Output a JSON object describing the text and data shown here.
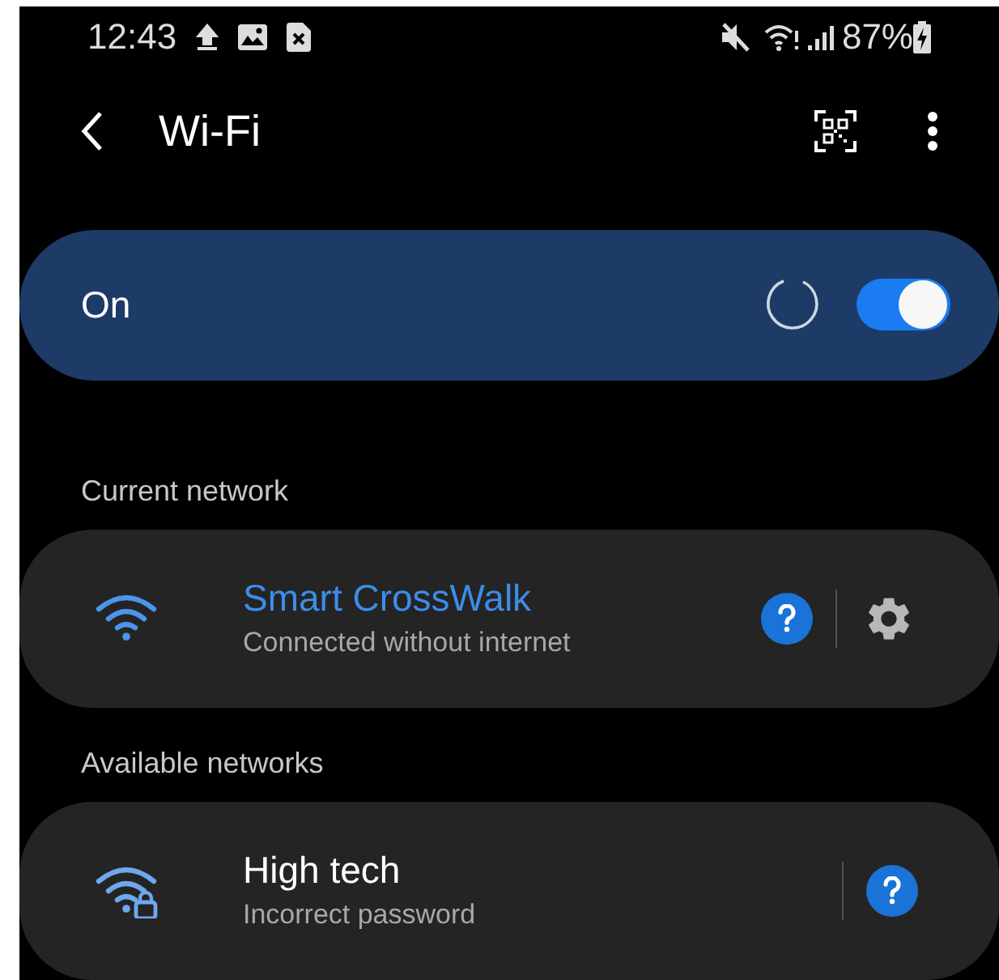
{
  "status_bar": {
    "time": "12:43",
    "battery": "87%"
  },
  "header": {
    "title": "Wi-Fi"
  },
  "master_switch": {
    "label": "On",
    "on": true,
    "scanning": true
  },
  "sections": [
    {
      "title": "Current network",
      "networks": [
        {
          "name": "Smart CrossWalk",
          "status": "Connected without internet",
          "connected": true,
          "secured": false,
          "kind": "current"
        }
      ]
    },
    {
      "title": "Available networks",
      "networks": [
        {
          "name": "High tech",
          "status": "Incorrect password",
          "connected": false,
          "secured": true,
          "kind": "available"
        }
      ]
    }
  ]
}
